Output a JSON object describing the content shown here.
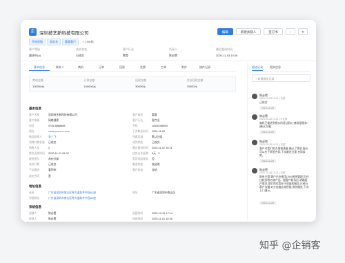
{
  "header": {
    "logo_char": "企",
    "company": "深圳技艺新科技有限公司",
    "tags": [
      "开始采购",
      "商务名",
      "重要客户"
    ],
    "tag_extra": "+ 1 Attr标",
    "buttons": {
      "primary": "编辑",
      "follow": "新建关联人",
      "more": "签订书",
      "dots": "···",
      "close": "✕"
    },
    "fields": [
      {
        "label": "客户等级",
        "value": "跟进中(A)"
      },
      {
        "label": "成交状态",
        "value": "已成交"
      },
      {
        "label": "客户行业",
        "value": "教育"
      },
      {
        "label": "负责人",
        "value": "陈必赞"
      },
      {
        "label": "最近跟进时间",
        "value": "2020-11-03 10:26"
      }
    ]
  },
  "tabs": [
    "基本信息",
    "联系人",
    "商机",
    "订单",
    "回款",
    "发票",
    "工单",
    "附件",
    "操作记录"
  ],
  "stats": [
    {
      "label": "商机金额",
      "value": "100000元"
    },
    {
      "label": "订单金额",
      "value": "100000元"
    },
    {
      "label": "回款金额",
      "value": "30000元"
    },
    {
      "label": "欠款回款金额",
      "value": "70000元"
    }
  ],
  "basic": {
    "title": "基本信息",
    "rows": [
      [
        {
          "k": "客户名称",
          "v": "深圳技艺新科技有限公司"
        },
        {
          "k": "客户级别",
          "v": "重要"
        }
      ],
      [
        {
          "k": "客户来源",
          "v": "网络搜索"
        },
        {
          "k": "客户行业",
          "v": "医疗业"
        }
      ],
      [
        {
          "k": "电话",
          "v": "0755-8888888"
        },
        {
          "k": "手机",
          "v": "18160066000"
        }
      ],
      [
        {
          "k": "网址",
          "v": "www.yuanmu.com",
          "link": true
        },
        {
          "k": "下次联系时间",
          "v": "2020-11-02"
        }
      ],
      [
        {
          "k": "微信联系人",
          "v": "李三飞",
          "link": true
        },
        {
          "k": "所属区域",
          "v": "默认分组"
        }
      ],
      [
        {
          "k": "消除付款状态",
          "v": "已成交"
        },
        {
          "k": "成交状态",
          "v": "已成交"
        }
      ],
      [
        {
          "k": "销售人员",
          "v": "2"
        },
        {
          "k": "最近跟进时间",
          "v": "2020-11-02 10:21"
        }
      ],
      [
        {
          "k": "首次业务时间",
          "v": "2020-11-01 09:00"
        },
        {
          "k": "成交允许延期",
          "v": "5天 · 3"
        }
      ],
      [
        {
          "k": "跟进团队",
          "v": "苏州分部"
        },
        {
          "k": "是否发起放弃",
          "v": "否"
        }
      ],
      [
        {
          "k": "成交开票",
          "v": "已成交"
        },
        {
          "k": "跟进状态",
          "v": "张启明"
        }
      ],
      [
        {
          "k": "下次跟进",
          "v": "看到你"
        },
        {
          "k": "客户状态",
          "v": "冻结"
        }
      ],
      [
        {
          "k": "成交合同",
          "v": "是"
        },
        {
          "k": "",
          "v": ""
        }
      ]
    ]
  },
  "address": {
    "title": "地址信息",
    "rows": [
      [
        {
          "k": "省份",
          "v": "广东省深圳市南山区粤大道软件中园A2座",
          "link": true
        },
        {
          "k": "地址",
          "v": "广东省深圳市南山区"
        }
      ],
      [
        {
          "k": "详细地址",
          "v": "广东省深圳市南山区粤大道软件中园A2座",
          "link": true
        },
        {
          "k": "",
          "v": ""
        }
      ]
    ]
  },
  "system": {
    "title": "系统信息",
    "rows": [
      [
        {
          "k": "创建人",
          "v": "陈必赞"
        },
        {
          "k": "创建时间",
          "v": "2020-10-31 17:14"
        }
      ],
      [
        {
          "k": "修改人",
          "v": "陈必赞"
        },
        {
          "k": "修改时间",
          "v": "2020-11-01 10:26"
        }
      ]
    ]
  },
  "right": {
    "tabs": [
      "跟进记录",
      "相关信息"
    ],
    "compose_placeholder": "+ 新建跟进记录",
    "items": [
      {
        "name": "陈必赞",
        "time": "2020-10-28 10:21 | 天前",
        "body": "已成交",
        "chip": "2020-10-28"
      },
      {
        "name": "陈必赞",
        "time": "2020-10-28 10:21 | 5 天前",
        "body": "商机已推进到报价阶段,[报价]“基础型服务”,[确认方案]",
        "chip": "2020-10-28"
      },
      {
        "name": "陈必赞",
        "time": "2020-10-28 10:21 | 天前",
        "body": "客户对我们的方案很满意,确认了需求,报价可以在下周签合同,下次跟进注意,合同条款。",
        "chip": "2020-10-28"
      },
      {
        "name": "陈必赞",
        "time": "2020-10-28 10:21 | 天前",
        "body": "联系主管,客户已在使用CRM系统管理,仍在比较多种价格产品。跟客户联系后,明确客户需求,我们的优势在于质量和服务,已经与客户沟通,对方态度比较积极,保持跟进,下次上门演示。",
        "chip": "2020-10-28"
      }
    ]
  },
  "watermark": "知乎 @企销客"
}
